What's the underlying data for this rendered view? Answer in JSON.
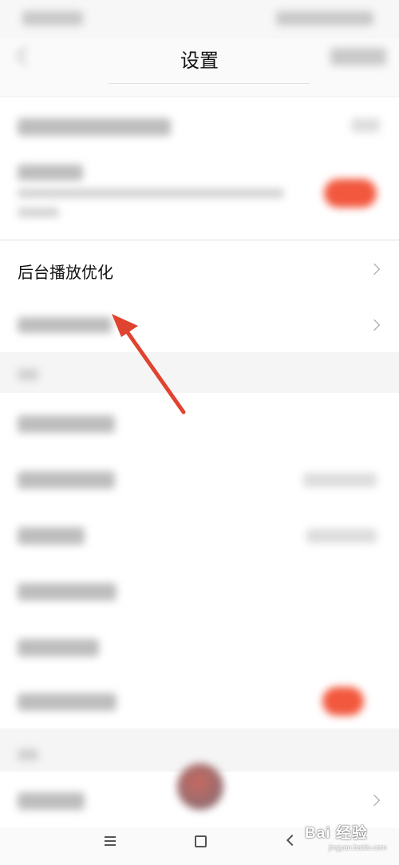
{
  "header": {
    "title": "设置"
  },
  "rows": {
    "background_play": "后台播放优化"
  },
  "watermark": {
    "text": "Bai 经验",
    "sub": "jingyan.baidu.com"
  },
  "colors": {
    "accent": "#f2583e",
    "arrow": "#e0432f",
    "page_bg": "#f5f5f5",
    "section_bg": "#ffffff"
  },
  "icons": {
    "back": "back-arrow-icon",
    "chevron": "chevron-right-icon",
    "menu": "menu-lines-icon",
    "home": "square-home-icon",
    "nav_back": "triangle-back-icon"
  }
}
